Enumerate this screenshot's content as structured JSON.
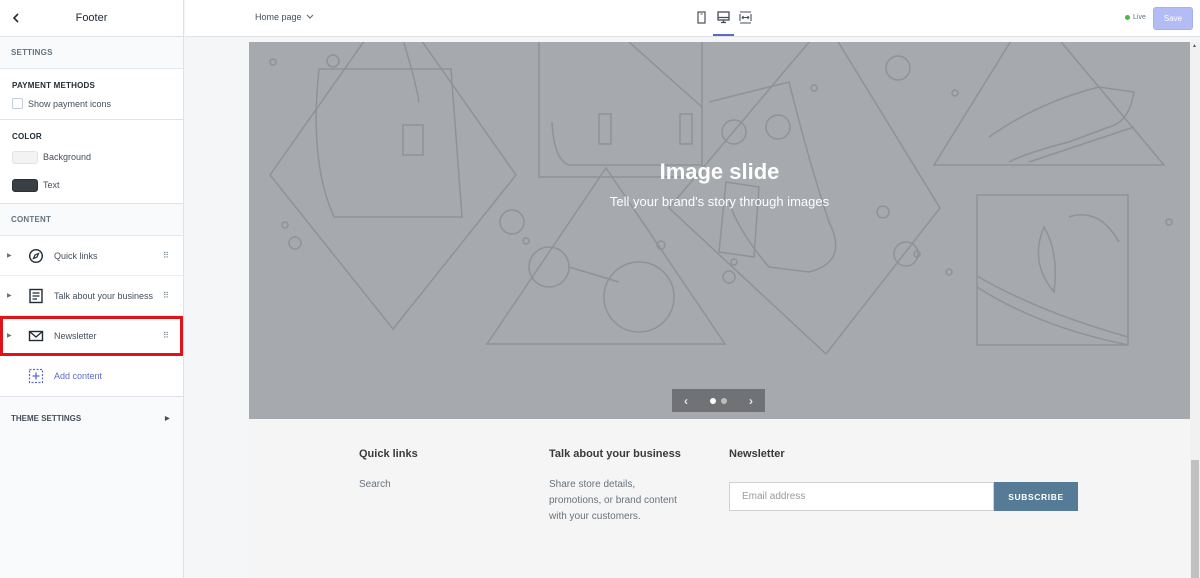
{
  "sidebar": {
    "title": "Footer",
    "settings_header": "SETTINGS",
    "payment_methods": {
      "title": "PAYMENT METHODS",
      "checkbox_label": "Show payment icons",
      "checked": false
    },
    "color": {
      "title": "COLOR",
      "items": [
        {
          "label": "Background",
          "value": "#f5f5f5"
        },
        {
          "label": "Text",
          "value": "#3a3a3a"
        }
      ]
    },
    "content_header": "CONTENT",
    "content_items": [
      {
        "label": "Quick links",
        "icon": "compass-icon"
      },
      {
        "label": "Talk about your business",
        "icon": "text-block-icon"
      },
      {
        "label": "Newsletter",
        "icon": "envelope-icon",
        "selected": true
      }
    ],
    "add_content_label": "Add content",
    "theme_settings_label": "THEME SETTINGS"
  },
  "topbar": {
    "page_select": "Home page",
    "devices": [
      "mobile",
      "desktop",
      "fullscreen"
    ],
    "active_device": "desktop",
    "status": "Live",
    "save_label": "Save"
  },
  "hero": {
    "title": "Image slide",
    "subtitle": "Tell your brand's story through images",
    "slide_count": 2,
    "active_slide": 1
  },
  "footer": {
    "quick_links": {
      "heading": "Quick links",
      "links": [
        "Search"
      ]
    },
    "business": {
      "heading": "Talk about your business",
      "text_lines": [
        "Share store details,",
        "promotions, or brand content",
        "with your customers."
      ]
    },
    "newsletter": {
      "heading": "Newsletter",
      "placeholder": "Email address",
      "button_label": "SUBSCRIBE"
    }
  }
}
